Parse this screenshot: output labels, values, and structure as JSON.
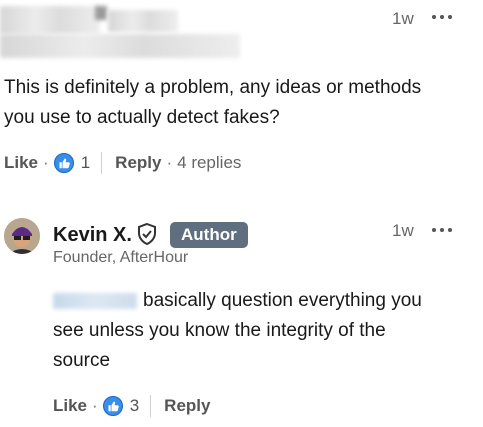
{
  "comment1": {
    "timestamp": "1w",
    "text_line1": "This is definitely a problem, any ideas or methods",
    "text_line2": "you use to actually detect fakes?",
    "like_label": "Like",
    "like_count": "1",
    "reply_label": "Reply",
    "replies_text": "4 replies"
  },
  "reply1": {
    "author_name": "Kevin X.",
    "author_badge": "Author",
    "headline": "Founder, AfterHour",
    "timestamp": "1w",
    "text_line1": "basically question everything you",
    "text_line2": "see unless you know the integrity of the",
    "text_line3": "source",
    "like_label": "Like",
    "like_count": "3",
    "reply_label": "Reply"
  },
  "separator": "·",
  "colors": {
    "reaction_blue": "#378fe9",
    "author_badge_bg": "#5f6f80",
    "muted_text": "#666666"
  },
  "icons": [
    "more-icon",
    "like-reaction-icon",
    "verified-shield-icon",
    "avatar"
  ]
}
